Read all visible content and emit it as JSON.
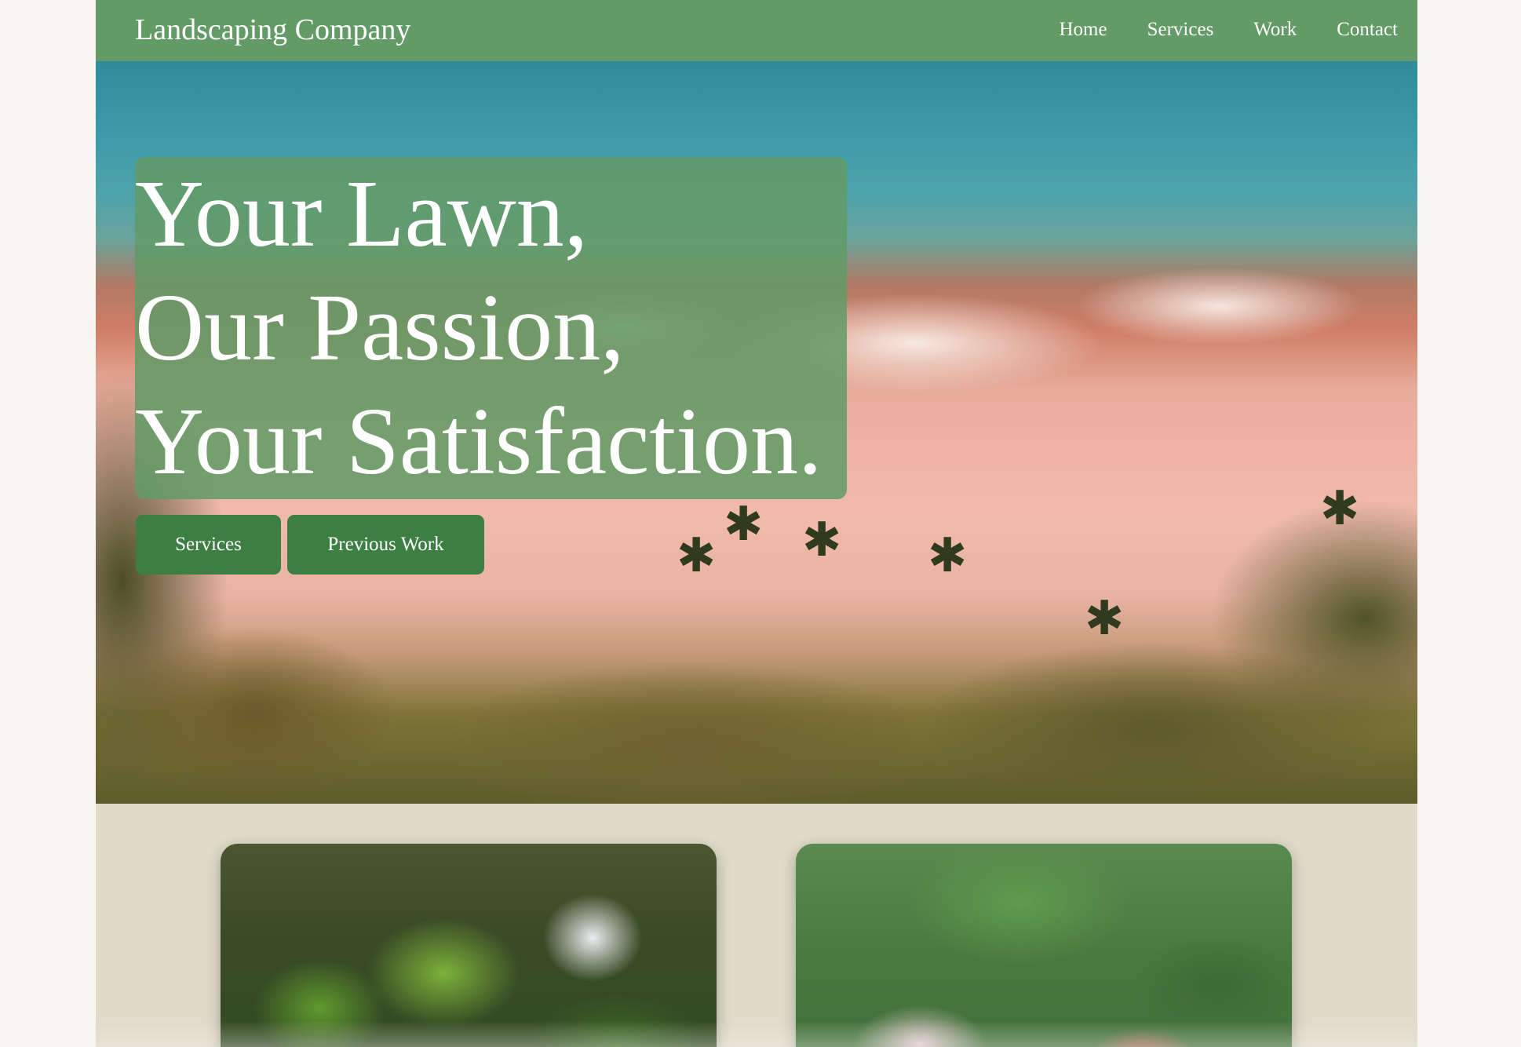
{
  "header": {
    "brand": "Landscaping Company",
    "nav": [
      {
        "label": "Home"
      },
      {
        "label": "Services"
      },
      {
        "label": "Work"
      },
      {
        "label": "Contact"
      }
    ]
  },
  "hero": {
    "heading_lines": [
      "Your Lawn,",
      "Our Passion,",
      "Your Satisfaction."
    ],
    "buttons": {
      "services": "Services",
      "previous_work": "Previous Work"
    }
  },
  "colors": {
    "nav_green": "#629b66",
    "button_green": "#3d7f42",
    "section_beige": "#dedbc8",
    "page_background": "#f7f4f1"
  },
  "images": [
    {
      "name": "hero-beach-aerial-image"
    },
    {
      "name": "tropical-garden-image"
    },
    {
      "name": "flower-garden-image"
    }
  ]
}
